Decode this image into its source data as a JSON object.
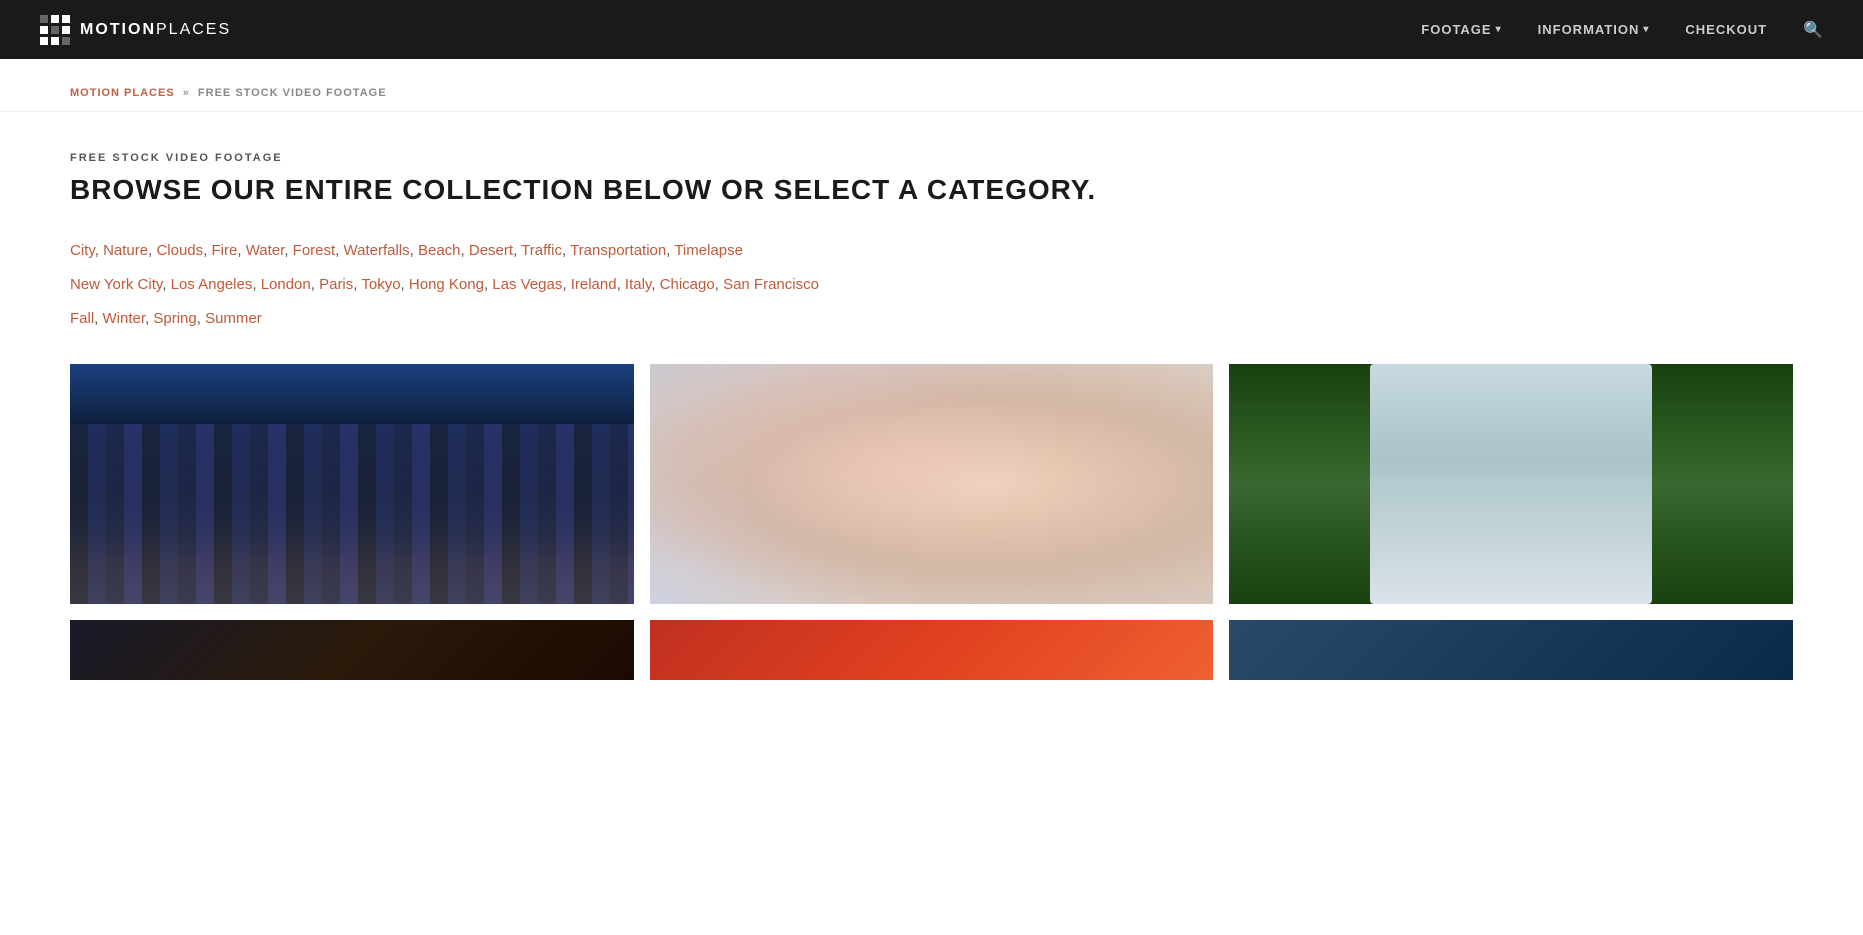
{
  "header": {
    "logo_text_bold": "MOTION",
    "logo_text_light": "PLACES",
    "nav": [
      {
        "label": "FOOTAGE",
        "has_dropdown": true
      },
      {
        "label": "INFORMATION",
        "has_dropdown": true
      },
      {
        "label": "CHECKOUT",
        "has_dropdown": false
      }
    ]
  },
  "breadcrumb": {
    "home": "MOTION PLACES",
    "separator": "»",
    "current": "FREE STOCK VIDEO FOOTAGE"
  },
  "main": {
    "section_label": "FREE STOCK VIDEO FOOTAGE",
    "section_title": "BROWSE OUR ENTIRE COLLECTION BELOW OR SELECT A CATEGORY.",
    "categories": {
      "row1": [
        "City",
        "Nature",
        "Clouds",
        "Fire",
        "Water",
        "Forest",
        "Waterfalls",
        "Beach",
        "Desert",
        "Traffic",
        "Transportation",
        "Timelapse"
      ],
      "row2": [
        "New York City",
        "Los Angeles",
        "London",
        "Paris",
        "Tokyo",
        "Hong Kong",
        "Las Vegas",
        "Ireland",
        "Italy",
        "Chicago",
        "San Francisco"
      ],
      "row3": [
        "Fall",
        "Winter",
        "Spring",
        "Summer"
      ]
    },
    "images": [
      {
        "id": "city",
        "alt": "City highway at night"
      },
      {
        "id": "blossom",
        "alt": "Cherry blossoms"
      },
      {
        "id": "waterfall",
        "alt": "Waterfall in green forest"
      }
    ]
  }
}
